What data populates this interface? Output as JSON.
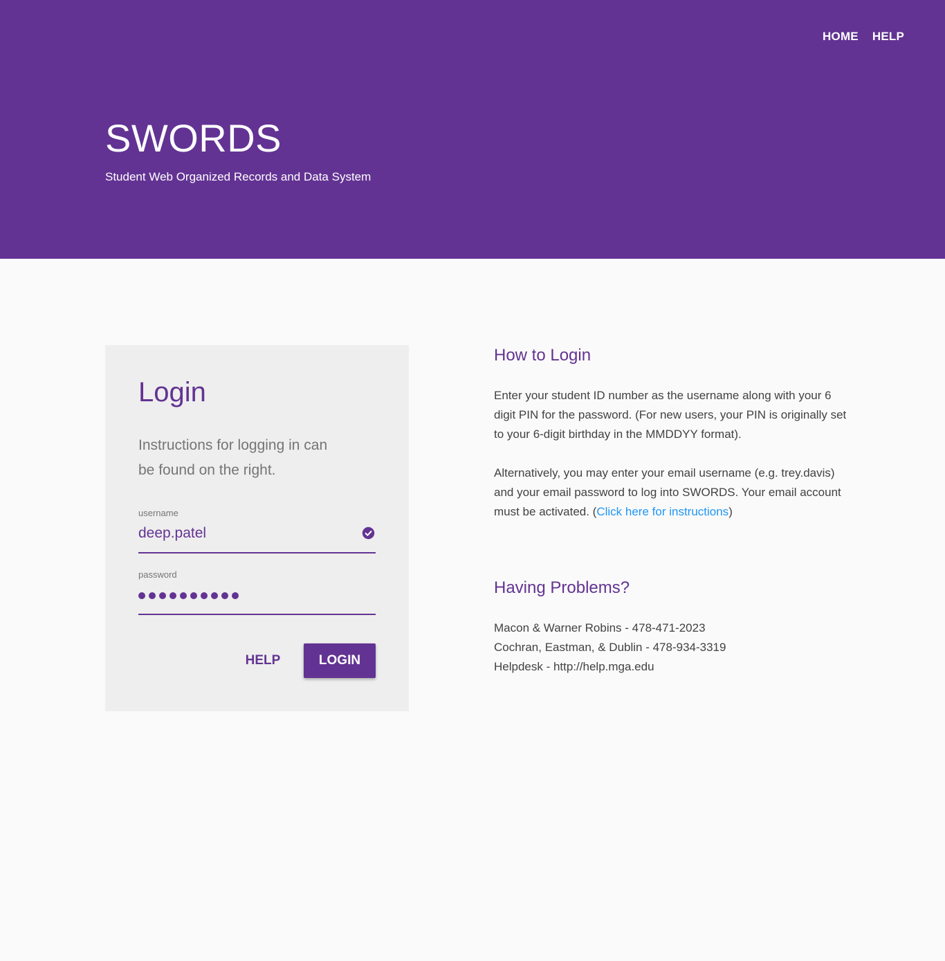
{
  "nav": {
    "home": "HOME",
    "help": "HELP"
  },
  "brand": {
    "title": "SWORDS",
    "subtitle": "Student Web Organized Records and Data System"
  },
  "login_card": {
    "title": "Login",
    "instructions": "Instructions for logging in can be found on the right.",
    "username_label": "username",
    "username_value": "deep.patel",
    "password_label": "password",
    "password_length": 10,
    "help_button": "HELP",
    "login_button": "LOGIN"
  },
  "how_to": {
    "title": "How to Login",
    "paragraph1": "Enter your student ID number as the username along with your 6 digit PIN for the password. (For new users, your PIN is originally set to your 6-digit birthday in the MMDDYY format).",
    "paragraph2_before": "Alternatively, you may enter your email username (e.g. trey.davis) and your email password to log into SWORDS. Your email account must be activated. (",
    "paragraph2_link": "Click here for instructions",
    "paragraph2_after": ")"
  },
  "problems": {
    "title": "Having Problems?",
    "contacts": [
      "Macon & Warner Robins  -  478-471-2023",
      "Cochran, Eastman, & Dublin  -  478-934-3319",
      "Helpdesk  -  http://help.mga.edu"
    ]
  },
  "colors": {
    "brand": "#633393",
    "link": "#2196f3",
    "background": "#fafafa",
    "card": "#eeeeee"
  }
}
